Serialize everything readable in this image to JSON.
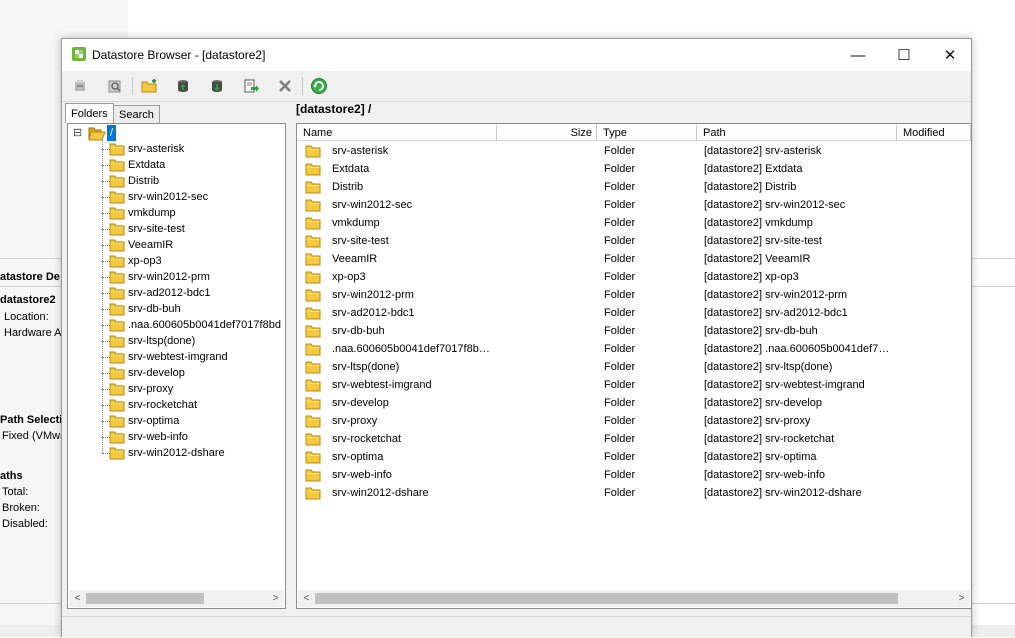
{
  "background": {
    "heading_datastore": "atastore De",
    "datastore_name": "datastore2",
    "location_label": "Location:",
    "hardware_label": "Hardware A",
    "path_selection_heading": "Path Selecti",
    "path_selection_value": "Fixed (VMwa",
    "paths_heading": "aths",
    "total_label": "Total:",
    "broken_label": "Broken:",
    "disabled_label": "Disabled:"
  },
  "window": {
    "title": "Datastore Browser - [datastore2]",
    "minimize_glyph": "—",
    "maximize_glyph": "☐",
    "close_glyph": "✕"
  },
  "toolbar": {
    "icons": [
      "database-icon",
      "search-folder-icon",
      "new-folder-icon",
      "upload-icon",
      "download-icon",
      "move-icon",
      "delete-icon",
      "refresh-icon"
    ]
  },
  "tabs": {
    "folders": "Folders",
    "search": "Search"
  },
  "current_path": "[datastore2] /",
  "tree": {
    "root_label": "/",
    "expander": "⊟",
    "items": [
      "srv-asterisk",
      "Extdata",
      "Distrib",
      "srv-win2012-sec",
      "vmkdump",
      "srv-site-test",
      "VeeamIR",
      "xp-op3",
      "srv-win2012-prm",
      "srv-ad2012-bdc1",
      "srv-db-buh",
      ".naa.600605b0041def7017f8bd",
      "srv-ltsp(done)",
      "srv-webtest-imgrand",
      "srv-develop",
      "srv-proxy",
      "srv-rocketchat",
      "srv-optima",
      "srv-web-info",
      "srv-win2012-dshare"
    ]
  },
  "list": {
    "columns": {
      "name": "Name",
      "size": "Size",
      "type": "Type",
      "path": "Path",
      "modified": "Modified"
    },
    "rows": [
      {
        "name": "srv-asterisk",
        "type": "Folder",
        "path": "[datastore2] srv-asterisk"
      },
      {
        "name": "Extdata",
        "type": "Folder",
        "path": "[datastore2] Extdata"
      },
      {
        "name": "Distrib",
        "type": "Folder",
        "path": "[datastore2] Distrib"
      },
      {
        "name": "srv-win2012-sec",
        "type": "Folder",
        "path": "[datastore2] srv-win2012-sec"
      },
      {
        "name": "vmkdump",
        "type": "Folder",
        "path": "[datastore2] vmkdump"
      },
      {
        "name": "srv-site-test",
        "type": "Folder",
        "path": "[datastore2] srv-site-test"
      },
      {
        "name": "VeeamIR",
        "type": "Folder",
        "path": "[datastore2] VeeamIR"
      },
      {
        "name": "xp-op3",
        "type": "Folder",
        "path": "[datastore2] xp-op3"
      },
      {
        "name": "srv-win2012-prm",
        "type": "Folder",
        "path": "[datastore2] srv-win2012-prm"
      },
      {
        "name": "srv-ad2012-bdc1",
        "type": "Folder",
        "path": "[datastore2] srv-ad2012-bdc1"
      },
      {
        "name": "srv-db-buh",
        "type": "Folder",
        "path": "[datastore2] srv-db-buh"
      },
      {
        "name": ".naa.600605b0041def7017f8b…",
        "type": "Folder",
        "path": "[datastore2] .naa.600605b0041def7…"
      },
      {
        "name": "srv-ltsp(done)",
        "type": "Folder",
        "path": "[datastore2] srv-ltsp(done)"
      },
      {
        "name": "srv-webtest-imgrand",
        "type": "Folder",
        "path": "[datastore2] srv-webtest-imgrand"
      },
      {
        "name": "srv-develop",
        "type": "Folder",
        "path": "[datastore2] srv-develop"
      },
      {
        "name": "srv-proxy",
        "type": "Folder",
        "path": "[datastore2] srv-proxy"
      },
      {
        "name": "srv-rocketchat",
        "type": "Folder",
        "path": "[datastore2] srv-rocketchat"
      },
      {
        "name": "srv-optima",
        "type": "Folder",
        "path": "[datastore2] srv-optima"
      },
      {
        "name": "srv-web-info",
        "type": "Folder",
        "path": "[datastore2] srv-web-info"
      },
      {
        "name": "srv-win2012-dshare",
        "type": "Folder",
        "path": "[datastore2] srv-win2012-dshare"
      }
    ]
  },
  "scroll": {
    "left_arrow": "<",
    "right_arrow": ">"
  },
  "colors": {
    "folder_fill": "#f5c842",
    "folder_stroke": "#b88a10",
    "selection": "#0078d7",
    "accent_green": "#2e9e3a"
  }
}
